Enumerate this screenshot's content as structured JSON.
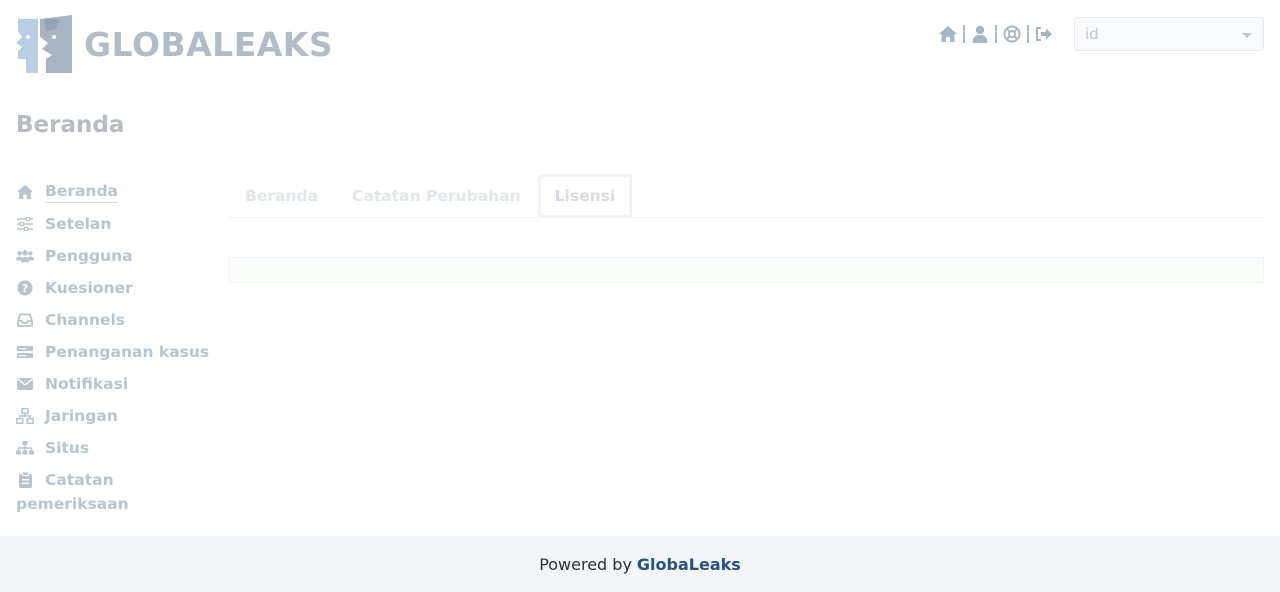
{
  "brand": {
    "logo_text": "GLOBALEAKS",
    "logo_icon": "globaleaks-faces-logo"
  },
  "header": {
    "icons": [
      "home-icon",
      "user-icon",
      "lifebuoy-icon",
      "logout-icon"
    ],
    "language": {
      "selected": "id"
    }
  },
  "page": {
    "title": "Beranda"
  },
  "sidebar": {
    "items": [
      {
        "label": "Beranda",
        "icon": "home-icon",
        "active": true
      },
      {
        "label": "Setelan",
        "icon": "sliders-icon"
      },
      {
        "label": "Pengguna",
        "icon": "users-icon"
      },
      {
        "label": "Kuesioner",
        "icon": "question-circle-icon"
      },
      {
        "label": "Channels",
        "icon": "inbox-icon"
      },
      {
        "label": "Penanganan kasus",
        "icon": "server-icon"
      },
      {
        "label": "Notifikasi",
        "icon": "envelope-icon"
      },
      {
        "label": "Jaringan",
        "icon": "network-icon"
      },
      {
        "label": "Situs",
        "icon": "sitemap-icon"
      },
      {
        "label": "Catatan pemeriksaan",
        "icon": "clipboard-icon"
      }
    ]
  },
  "tabs": [
    {
      "label": "Beranda"
    },
    {
      "label": "Catatan Perubahan"
    },
    {
      "label": "Lisensi",
      "active": true
    }
  ],
  "footer": {
    "prefix": "Powered by",
    "brand": "GlobaLeaks"
  },
  "colors": {
    "nav": "#b8c4d0",
    "footer_brand": "#2a5280",
    "footer_bg": "#f4f5f9"
  }
}
